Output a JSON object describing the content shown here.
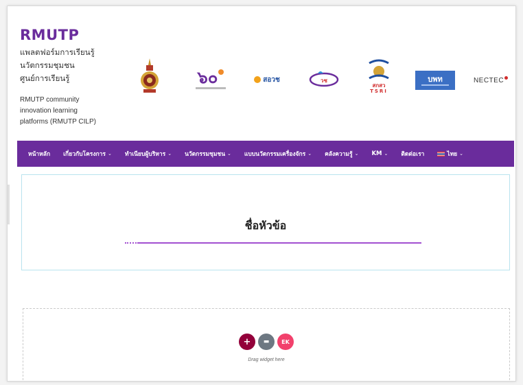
{
  "brand": {
    "title": "RMUTP",
    "thai_lines": "แพลตฟอร์มการเรียนรู้\nนวัตกรรมชุมชน\nศูนย์การเรียนรู้",
    "english_lines": "RMUTP community\ninnovation learning\nplatforms (RMUTP CILP)"
  },
  "logos": [
    {
      "icon": "university-crest-icon"
    },
    {
      "icon": "anniversary-logo-icon",
      "text": "๖๐"
    },
    {
      "icon": "tsri-logo-icon",
      "text": "สอวช"
    },
    {
      "icon": "agency-logo-icon",
      "text": "วช"
    },
    {
      "icon": "sksw-logo-icon",
      "text": "สกสว",
      "subtext": "TSRI"
    },
    {
      "icon": "pmu-logo-icon",
      "text": "บพท"
    },
    {
      "icon": "nectec-logo-icon",
      "text": "NECTEC"
    }
  ],
  "nav": {
    "items": [
      {
        "label": "หน้าหลัก",
        "dropdown": false
      },
      {
        "label": "เกี่ยวกับโครงการ",
        "dropdown": true
      },
      {
        "label": "ทำเนียบผู้บริหาร",
        "dropdown": true
      },
      {
        "label": "นวัตกรรมชุมชน",
        "dropdown": true
      },
      {
        "label": "แบบนวัตกรรมเครื่องจักร",
        "dropdown": true
      },
      {
        "label": "คลังความรู้",
        "dropdown": true
      },
      {
        "label": "KM",
        "dropdown": true
      },
      {
        "label": "ติดต่อเรา",
        "dropdown": false
      }
    ],
    "language": {
      "label": "ไทย",
      "icon": "thai-flag-icon"
    }
  },
  "section": {
    "heading": "ชื่อหัวข้อ"
  },
  "dropzone": {
    "hint": "Drag widget here",
    "buttons": [
      {
        "icon": "add-icon",
        "glyph": "+",
        "color": "#93003a"
      },
      {
        "icon": "folder-icon",
        "glyph": "▬",
        "color": "#6d7882"
      },
      {
        "icon": "elementor-icon",
        "glyph": "EK",
        "color": "#f2416c"
      }
    ]
  },
  "colors": {
    "brand_purple": "#6a2c9c",
    "divider": "#a24fd1",
    "section_border": "#b8e3ee"
  }
}
